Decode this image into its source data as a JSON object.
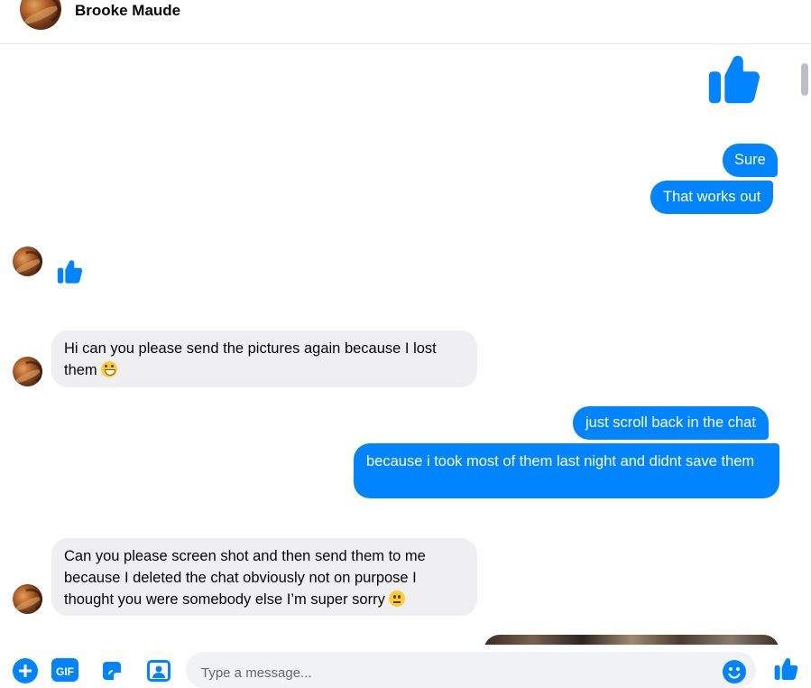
{
  "header": {
    "contact_name": "Brooke Maude"
  },
  "messages": {
    "m1": "Sure",
    "m2": "That works out",
    "m3_text": "Hi can you please send the pictures again because I lost them",
    "m4": "just scroll back in the chat",
    "m5": "because i took most of them last night and didnt save them",
    "m6_text": "Can you please screen shot and then send them to me because I deleted the chat obviously not on purpose I thought you were somebody else I’m super sorry"
  },
  "composer": {
    "gif_label": "GIF",
    "placeholder": "Type a message..."
  },
  "icons": {
    "large_like": "thumbs-up-icon",
    "small_like": "thumbs-up-icon",
    "add": "plus-circle-icon",
    "gif": "gif-icon",
    "sticker": "sticker-icon",
    "image": "image-icon",
    "emoji": "smiley-icon",
    "send_like": "thumbs-up-icon"
  },
  "colors": {
    "accent": "#0084ff",
    "incoming_bubble": "#efeff1",
    "outgoing_text": "#ffffff"
  }
}
